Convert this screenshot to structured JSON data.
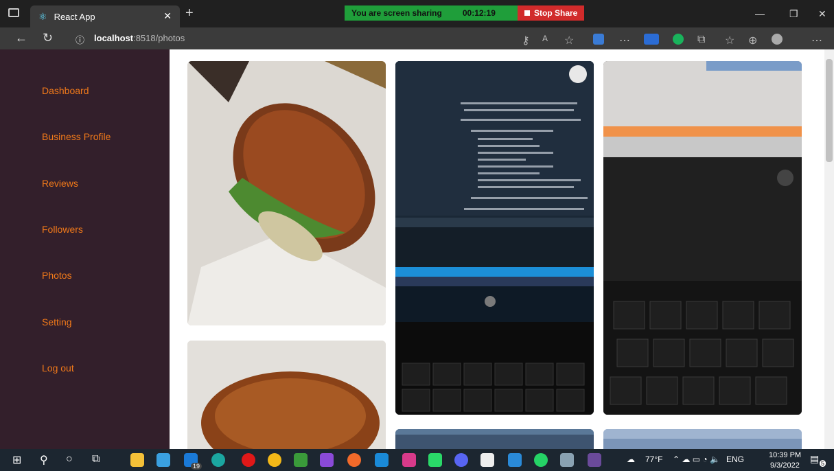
{
  "browser": {
    "tab_title": "React App",
    "url_host": "localhost",
    "url_path": ":8518/photos"
  },
  "screen_share": {
    "status": "You are screen sharing",
    "timer": "00:12:19",
    "stop_label": "Stop Share"
  },
  "sidebar": {
    "items": [
      {
        "label": "Dashboard"
      },
      {
        "label": "Business Profile"
      },
      {
        "label": "Reviews"
      },
      {
        "label": "Followers"
      },
      {
        "label": "Photos"
      },
      {
        "label": "Setting"
      },
      {
        "label": "Log out"
      }
    ]
  },
  "photos": [
    {
      "subject": "burger-photo"
    },
    {
      "subject": "laptop-code-photo"
    },
    {
      "subject": "laptop-keyboard-photo"
    },
    {
      "subject": "burger-photo"
    },
    {
      "subject": "laptop-photo"
    },
    {
      "subject": "laptop-photo"
    }
  ],
  "taskbar": {
    "weather": "77°F",
    "language": "ENG",
    "time": "10:39 PM",
    "date": "9/3/2022",
    "notification_count": "5",
    "mail_badge": "19"
  },
  "colors": {
    "sidebar_bg": "#331f2b",
    "accent": "#f27a1a"
  }
}
